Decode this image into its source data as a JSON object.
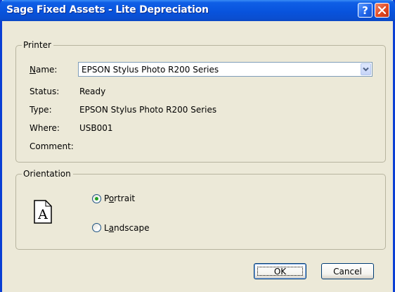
{
  "window": {
    "title": "Sage Fixed Assets - Lite Depreciation",
    "help_glyph": "?",
    "close_icon": "close-icon"
  },
  "printer": {
    "group_label": "Printer",
    "name_label_mnemonic": "N",
    "name_label_rest": "ame:",
    "name_value": "EPSON Stylus Photo R200 Series",
    "status_label": "Status:",
    "status_value": "Ready",
    "type_label": "Type:",
    "type_value": "EPSON Stylus Photo R200 Series",
    "where_label": "Where:",
    "where_value": "USB001",
    "comment_label": "Comment:",
    "comment_value": ""
  },
  "orientation": {
    "group_label": "Orientation",
    "icon_letter": "A",
    "portrait_mnemonic": "o",
    "portrait_pre": "P",
    "portrait_post": "rtrait",
    "landscape_mnemonic": "a",
    "landscape_pre": "L",
    "landscape_post": "ndscape",
    "selected": "portrait"
  },
  "buttons": {
    "ok_label": "OK",
    "cancel_label": "Cancel"
  },
  "colors": {
    "titlebar": "#0853dd",
    "dialog_bg": "#ece9d8",
    "close_button": "#e0471e",
    "radio_selected": "#21a121"
  }
}
